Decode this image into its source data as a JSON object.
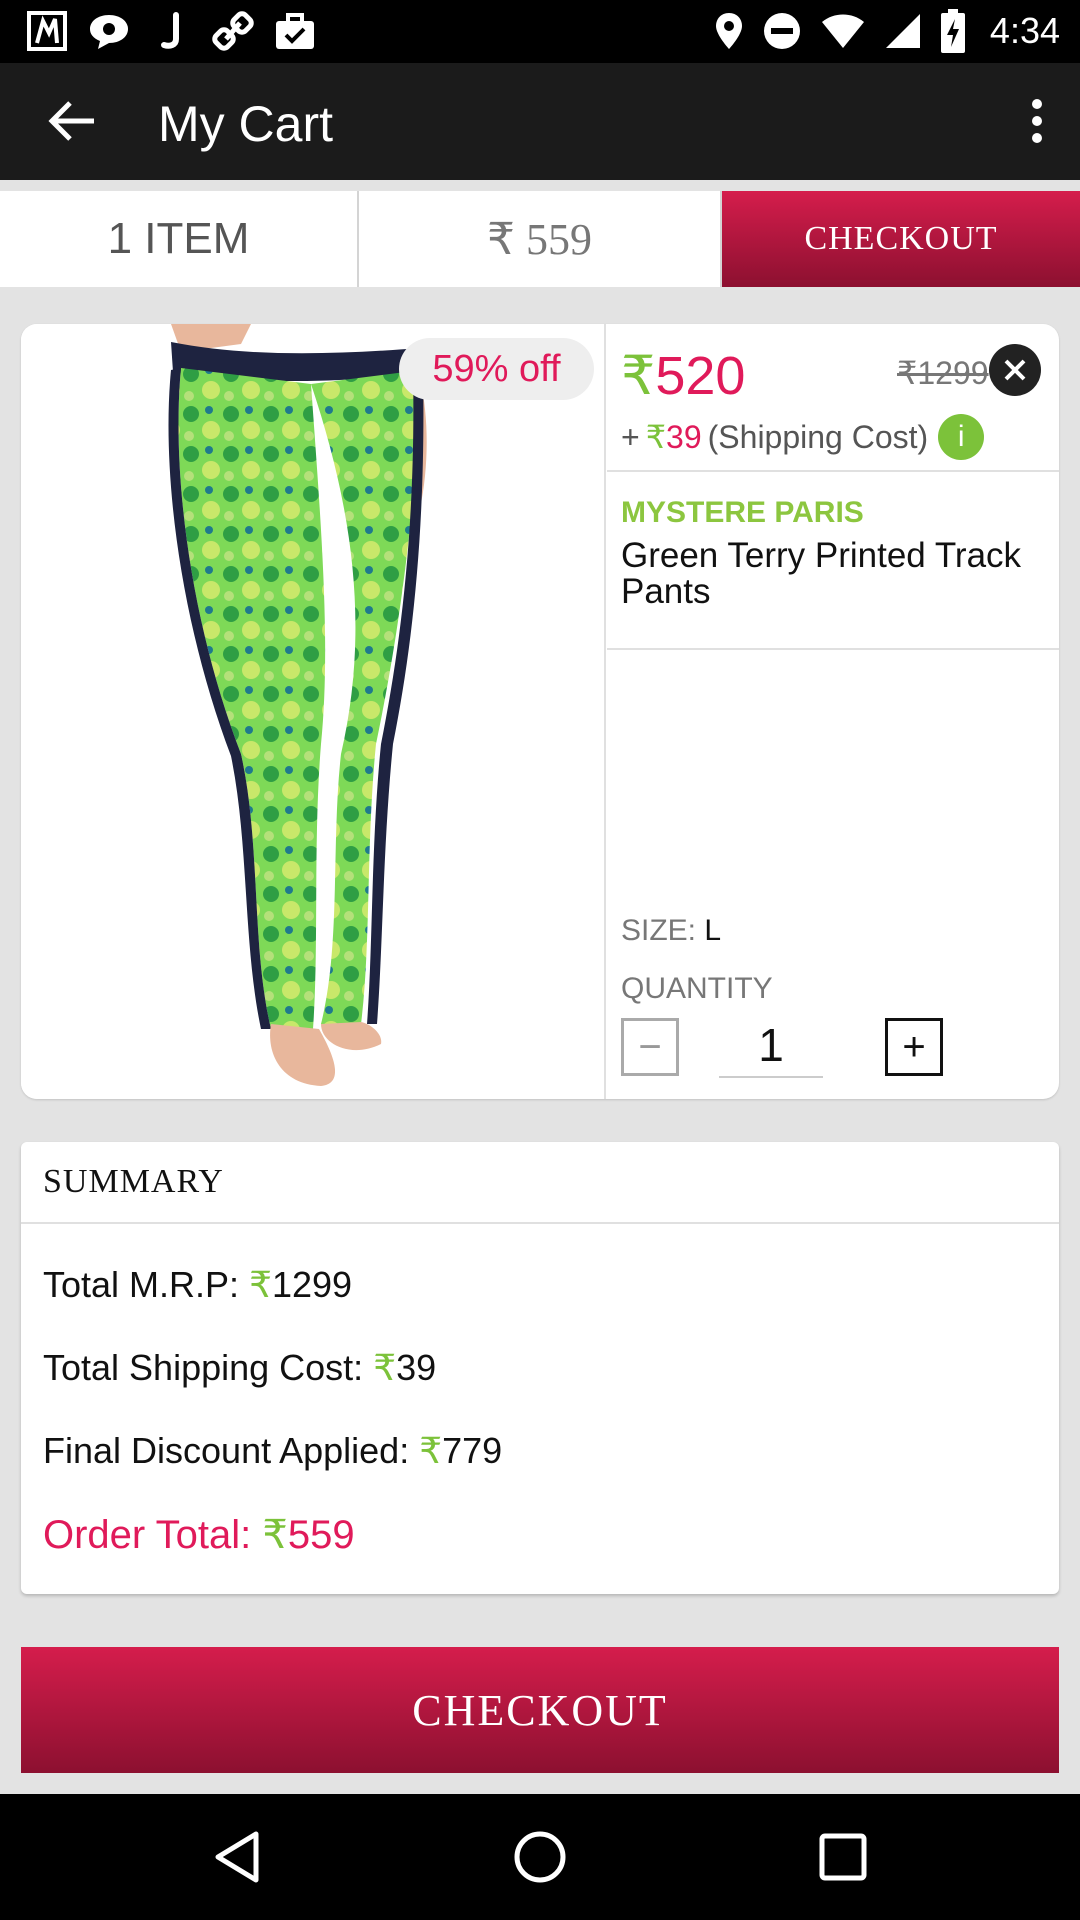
{
  "status_bar": {
    "time": "4:34",
    "left_icons": [
      "app-notification-icon",
      "chat-icon",
      "jabong-icon",
      "link-icon",
      "briefcase-check-icon"
    ],
    "right_icons": [
      "location-icon",
      "do-not-disturb-icon",
      "wifi-icon",
      "signal-icon",
      "battery-charging-icon"
    ]
  },
  "app_bar": {
    "title": "My Cart"
  },
  "cart_strip": {
    "items_label": "1 ITEM",
    "price_label": "₹ 559",
    "checkout_label": "CHECKOUT"
  },
  "product": {
    "discount_badge": "59% off",
    "price_symbol": "₹",
    "price": "520",
    "mrp": "₹1299",
    "shipping_prefix": "+",
    "shipping_symbol": "₹",
    "shipping_amount": "39",
    "shipping_label": "(Shipping Cost)",
    "info_label": "i",
    "brand": "MYSTERE PARIS",
    "name": "Green Terry Printed Track Pants",
    "size_label": "SIZE:",
    "size_value": "L",
    "quantity_label": "QUANTITY",
    "quantity_minus": "−",
    "quantity_value": "1",
    "quantity_plus": "+"
  },
  "summary": {
    "title": "SUMMARY",
    "rows": [
      {
        "label": "Total M.R.P:",
        "symbol": "₹",
        "value": "1299"
      },
      {
        "label": "Total Shipping Cost:",
        "symbol": "₹",
        "value": "39"
      },
      {
        "label": "Final Discount Applied:",
        "symbol": "₹",
        "value": "779"
      }
    ],
    "order_total_label": "Order Total:",
    "order_total_symbol": "₹",
    "order_total_value": "559"
  },
  "checkout_button": {
    "label": "CHECKOUT"
  },
  "colors": {
    "accent_pink": "#e01a5a",
    "checkout_red": "#c8173f",
    "rupee_green": "#7cc23a",
    "app_bar": "#1b1b1b"
  }
}
